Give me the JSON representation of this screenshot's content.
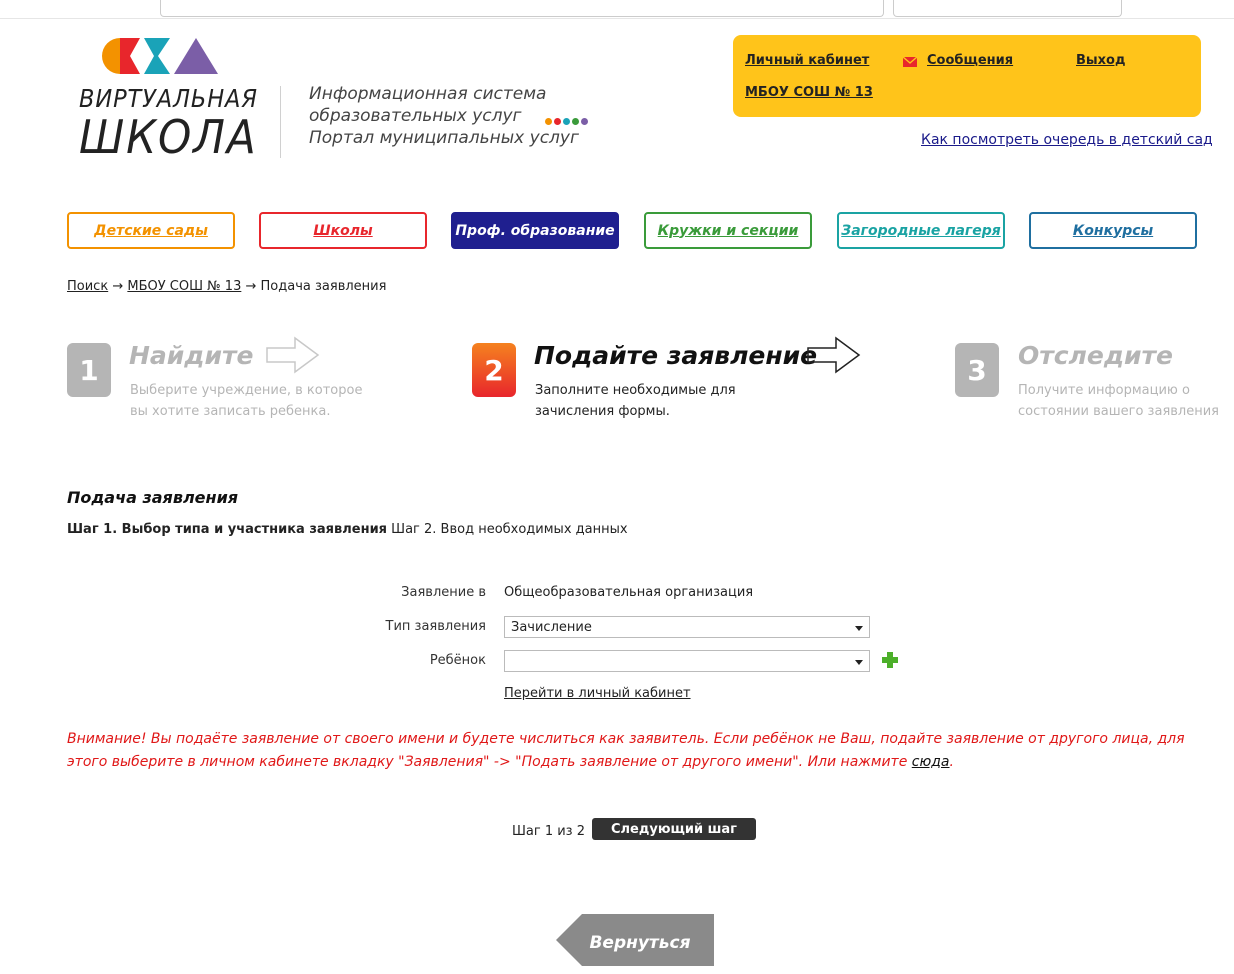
{
  "logo": {
    "line1": "ВИРТУАЛЬНАЯ",
    "line2": "ШКОЛА",
    "shape_colors": [
      "#f39200",
      "#e8262c",
      "#1aa3b8",
      "#7b5ea7"
    ]
  },
  "tagline": {
    "line1": "Информационная система",
    "line2": "образовательных услуг",
    "line3": "Портал муниципальных услуг",
    "dot_colors": [
      "#f39200",
      "#e8262c",
      "#1aa3b8",
      "#3a9b3a",
      "#7b5ea7"
    ]
  },
  "userbox": {
    "cabinet": "Личный кабинет",
    "messages": "Сообщения",
    "logout": "Выход",
    "org": "МБОУ СОШ № 13",
    "background": "#ffc41a"
  },
  "queue_link": "Как посмотреть очередь в детский сад",
  "tabs": [
    {
      "label": "Детские сады",
      "color": "#f39200"
    },
    {
      "label": "Школы",
      "color": "#e8262c"
    },
    {
      "label": "Проф. образование",
      "color": "#1f1f8f"
    },
    {
      "label": "Кружки и секции",
      "color": "#3a9b3a"
    },
    {
      "label": "Загородные лагеря",
      "color": "#1aa3a3"
    },
    {
      "label": "Конкурсы",
      "color": "#1f6fa0"
    }
  ],
  "breadcrumb": {
    "search": "Поиск",
    "sep1": "→",
    "school": "МБОУ СОШ № 13",
    "sep2": "→",
    "current": "Подача заявления"
  },
  "steps": [
    {
      "num": "1",
      "title": "Найдите",
      "desc1": "Выберите учреждение, в которое",
      "desc2": "вы хотите записать ребенка."
    },
    {
      "num": "2",
      "title": "Подайте заявление",
      "desc1": "Заполните необходимые для",
      "desc2": "зачисления формы."
    },
    {
      "num": "3",
      "title": "Отследите",
      "desc1": "Получите информацию о",
      "desc2": "состоянии вашего заявления"
    }
  ],
  "section": {
    "title": "Подача заявления",
    "step1": "Шаг 1. Выбор типа и участника заявления",
    "step2": "Шаг 2. Ввод необходимых данных"
  },
  "form": {
    "org_label": "Заявление в",
    "org_value": "Общеобразовательная организация",
    "type_label": "Тип заявления",
    "type_value": "Зачисление",
    "child_label": "Ребёнок",
    "child_value": "",
    "cabinet_link": "Перейти в личный кабинет"
  },
  "warning": {
    "text": "Внимание! Вы подаёте заявление от своего имени и будете числиться как заявитель. Если ребёнок не Ваш, подайте заявление от другого лица, для этого выберите в личном кабинете вкладку \"Заявления\" -> \"Подать заявление от другого имени\". Или нажмите ",
    "link": "сюда",
    "end": "."
  },
  "pager": {
    "text": "Шаг 1 из 2",
    "next": "Следующий шаг"
  },
  "back_button": "Вернуться"
}
